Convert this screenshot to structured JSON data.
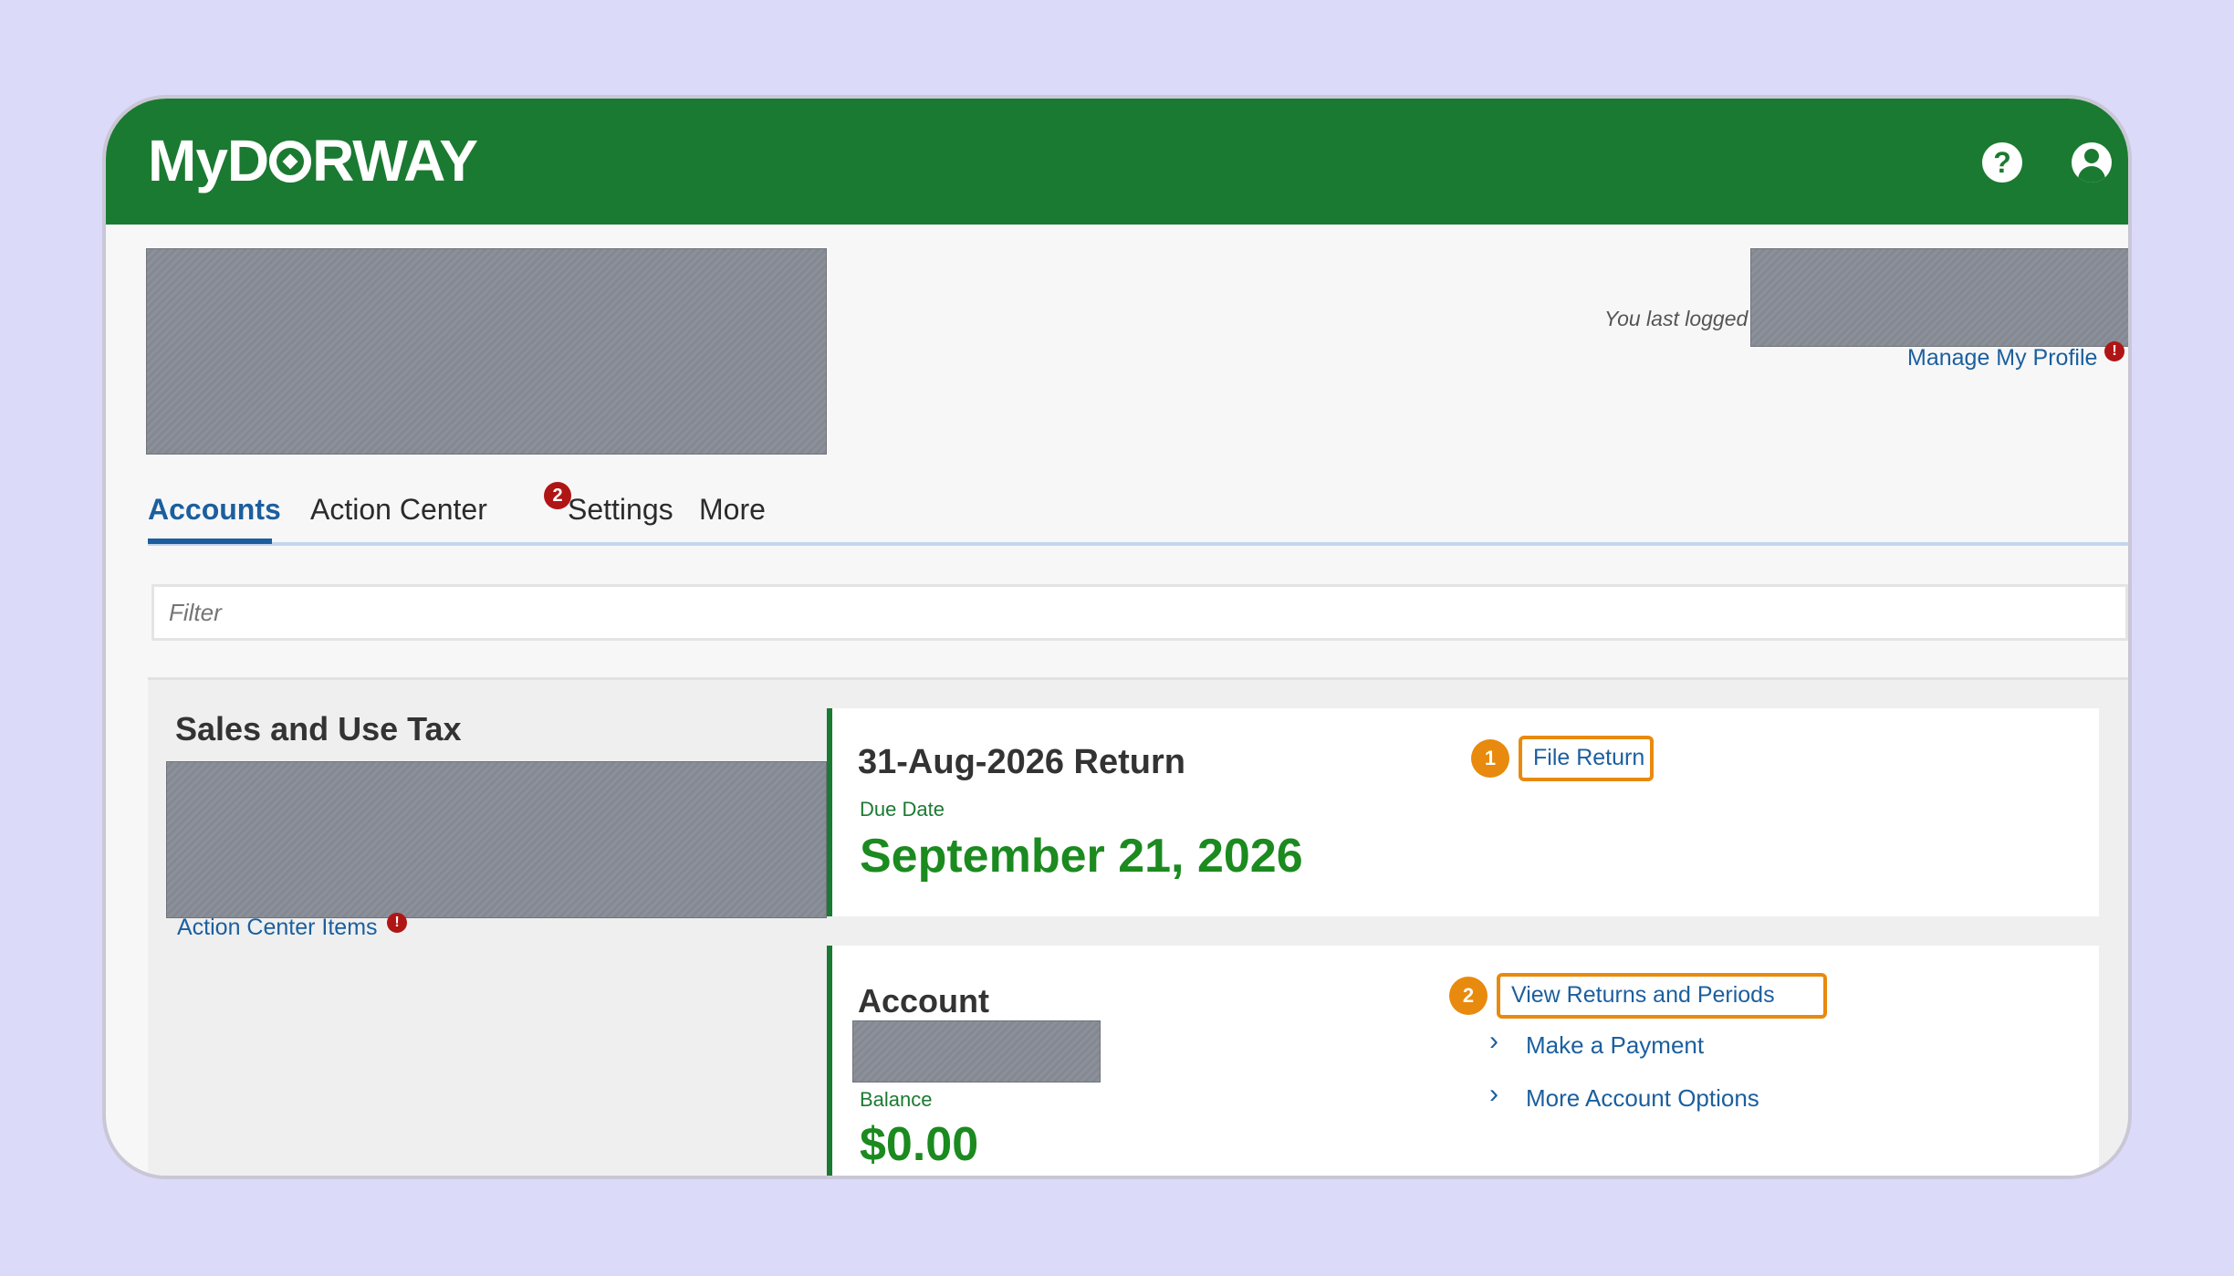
{
  "header": {
    "logo_text_before": "MyD",
    "logo_text_after": "RWAY",
    "help_icon": "?",
    "icons": [
      "help-icon",
      "user-icon"
    ]
  },
  "profile": {
    "last_logged": "You last logged",
    "manage_profile": "Manage My Profile",
    "manage_profile_badge": "!"
  },
  "tabs": [
    {
      "label": "Accounts",
      "active": true
    },
    {
      "label": "Action Center",
      "badge": "2"
    },
    {
      "label": "Settings"
    },
    {
      "label": "More"
    }
  ],
  "filter": {
    "placeholder": "Filter"
  },
  "account_summary": {
    "title": "Sales and Use Tax",
    "action_center_items": "Action Center Items",
    "action_center_badge": "!"
  },
  "return_card": {
    "title": "31-Aug-2026 Return",
    "due_label": "Due Date",
    "due_date": "September 21, 2026",
    "step": "1",
    "file_return": "File Return"
  },
  "account_card": {
    "title": "Account",
    "balance_label": "Balance",
    "balance": "$0.00",
    "step": "2",
    "options": [
      "View Returns and Periods",
      "Make a Payment",
      "More Account Options"
    ]
  },
  "colors": {
    "brand_green": "#1b7a31",
    "link_blue": "#1b5f9e",
    "highlight_orange": "#e88a0d",
    "background": "#dcdaf9"
  }
}
